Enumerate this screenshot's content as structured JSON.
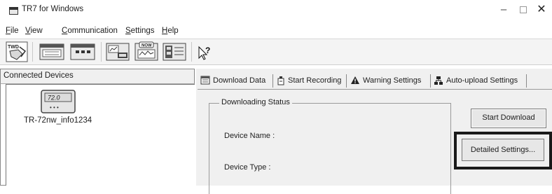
{
  "window": {
    "title": "TR7 for Windows",
    "minimize_glyph": "–",
    "close_glyph": "✕"
  },
  "menu": [
    {
      "accel": "F",
      "rest": "ile"
    },
    {
      "accel": "V",
      "rest": "iew"
    },
    {
      "accel": "C",
      "rest": "ommunication"
    },
    {
      "accel": "S",
      "rest": "ettings"
    },
    {
      "accel": "H",
      "rest": "elp"
    }
  ],
  "toolbar": {
    "icons": [
      "download-data-icon",
      "device-list-icon",
      "display-icon",
      "recording-icon",
      "now-reading-icon",
      "detail-view-icon",
      "help-cursor-icon"
    ],
    "badge_twd": "TWD",
    "badge_now": "NOW"
  },
  "left_panel": {
    "header": "Connected Devices",
    "device": {
      "name": "TR-72nw_info1234",
      "screen_value": "72.0",
      "dots": "• • •"
    }
  },
  "tabs": [
    {
      "label": "Download Data",
      "icon": "download-tab-icon",
      "active": true
    },
    {
      "label": "Start Recording",
      "icon": "recording-tab-icon",
      "active": false
    },
    {
      "label": "Warning Settings",
      "icon": "warning-tab-icon",
      "active": false
    },
    {
      "label": "Auto-upload Settings",
      "icon": "auto-upload-tab-icon",
      "active": false
    }
  ],
  "download": {
    "group_title": "Downloading Status",
    "device_name_label": "Device Name :",
    "device_type_label": "Device Type :",
    "start_button": "Start Download",
    "detailed_button": "Detailed Settings..."
  },
  "colors": {
    "panel_bg": "#f0f0f0",
    "highlight_border": "#1a1a1a",
    "button_face": "#e7e7e7"
  }
}
